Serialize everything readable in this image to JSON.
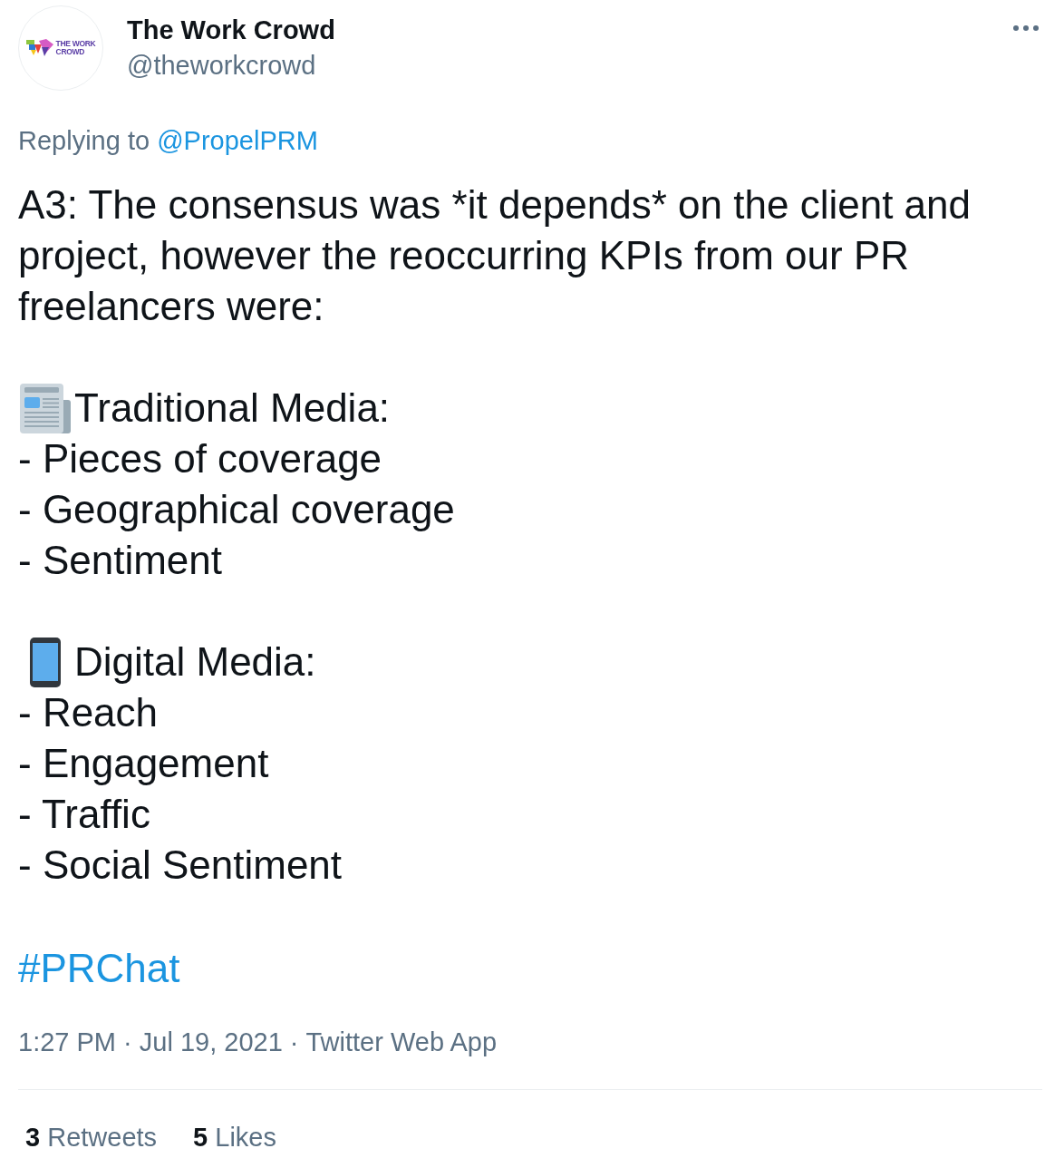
{
  "header": {
    "avatar": {
      "logo_lines": [
        "THE WORK",
        "CROWD"
      ]
    },
    "name": "The Work Crowd",
    "handle": "@theworkcrowd"
  },
  "reply_context": {
    "label": "Replying to",
    "mention": "@PropelPRM"
  },
  "body": {
    "intro": "A3: The consensus was *it depends* on the client and project, however the reoccurring KPIs from our PR freelancers were:",
    "sections": [
      {
        "kind": "newspaper",
        "heading": "Traditional Media:",
        "items": [
          "- Pieces of coverage",
          "- Geographical coverage",
          "- Sentiment"
        ]
      },
      {
        "kind": "phone",
        "heading": "Digital Media:",
        "items": [
          "- Reach",
          "- Engagement",
          "- Traffic",
          "- Social Sentiment"
        ]
      }
    ],
    "hashtag": "#PRChat"
  },
  "meta": {
    "timestamp": "1:27 PM · Jul 19, 2021",
    "separator": "·",
    "source": "Twitter Web App"
  },
  "stats": [
    {
      "count": "3",
      "label": "Retweets"
    },
    {
      "count": "5",
      "label": "Likes"
    }
  ]
}
